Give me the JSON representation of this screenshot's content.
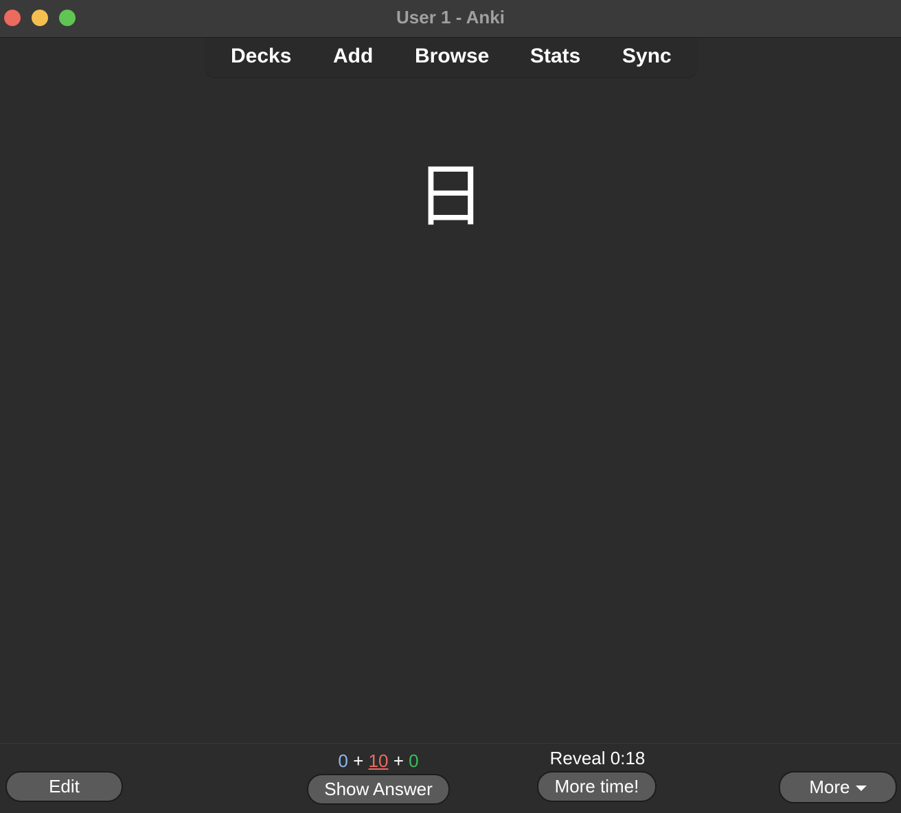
{
  "window": {
    "title": "User 1 - Anki"
  },
  "toolbar": {
    "items": [
      {
        "label": "Decks"
      },
      {
        "label": "Add"
      },
      {
        "label": "Browse"
      },
      {
        "label": "Stats"
      },
      {
        "label": "Sync"
      }
    ]
  },
  "card": {
    "front": "日"
  },
  "bottom": {
    "edit_label": "Edit",
    "counts": {
      "new": "0",
      "sep1": "+",
      "learn": "10",
      "sep2": "+",
      "review": "0"
    },
    "show_answer_label": "Show Answer",
    "reveal_text": "Reveal 0:18",
    "more_time_label": "More time!",
    "more_label": "More"
  },
  "colors": {
    "background": "#2c2c2c",
    "titlebar": "#3a3a3a",
    "button": "#5a5a5a",
    "count_new": "#8fb8ee",
    "count_learn": "#ec6b63",
    "count_review": "#39c05a",
    "traffic_close": "#ed6a5e",
    "traffic_minimize": "#f5bf4f",
    "traffic_maximize": "#61c554"
  },
  "icons": {
    "more_caret": "caret-down-icon"
  }
}
